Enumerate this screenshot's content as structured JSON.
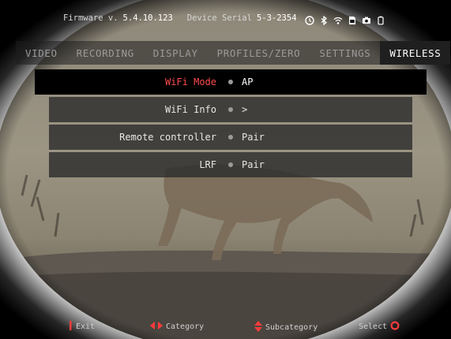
{
  "device": {
    "firmware_label": "Firmware v.",
    "firmware_value": "5.4.10.123",
    "serial_label": "Device Serial",
    "serial_value": "5-3-2354",
    "status_icons": [
      "timer-icon",
      "bluetooth-icon",
      "wifi-icon",
      "sd-card-icon",
      "camera-icon",
      "battery-icon"
    ]
  },
  "tabs": [
    {
      "label": "VIDEO"
    },
    {
      "label": "RECORDING"
    },
    {
      "label": "DISPLAY"
    },
    {
      "label": "PROFILES/ZERO"
    },
    {
      "label": "SETTINGS"
    },
    {
      "label": "WIRELESS"
    }
  ],
  "menu": [
    {
      "label": "WiFi Mode",
      "value": "AP"
    },
    {
      "label": "WiFi Info",
      "value": ">"
    },
    {
      "label": "Remote controller",
      "value": "Pair"
    },
    {
      "label": "LRF",
      "value": "Pair"
    }
  ],
  "hints": {
    "exit": "Exit",
    "category": "Category",
    "subcategory": "Subcategory",
    "select": "Select"
  },
  "colors": {
    "accent": "#ff4a4a",
    "active_row_bg": "#000000",
    "row_bg": "#2d2d2d"
  }
}
